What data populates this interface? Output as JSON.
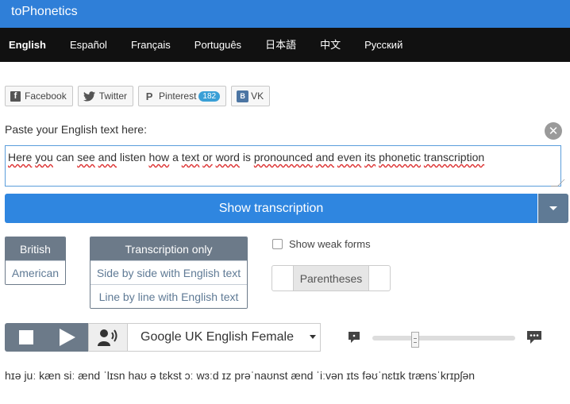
{
  "brand": "toPhonetics",
  "languages": [
    "English",
    "Español",
    "Français",
    "Português",
    "日本語",
    "中文",
    "Русский"
  ],
  "social": {
    "facebook": "Facebook",
    "twitter": "Twitter",
    "pinterest": "Pinterest",
    "pinterest_count": "182",
    "vk": "VK"
  },
  "input": {
    "label": "Paste your English text here:",
    "words": [
      "Here",
      "you",
      "can",
      "see",
      "and",
      "listen",
      "how",
      "a",
      "text",
      "or",
      "word",
      "is",
      "pronounced",
      "and",
      "even",
      "its",
      "phonetic",
      "transcription"
    ]
  },
  "show_button": "Show transcription",
  "accent": {
    "options": [
      "British",
      "American"
    ],
    "selected": "British"
  },
  "mode": {
    "options": [
      "Transcription only",
      "Side by side with English text",
      "Line by line with English text"
    ],
    "selected": "Transcription only"
  },
  "weak_forms": {
    "label": "Show weak forms",
    "checked": false
  },
  "parentheses": "Parentheses",
  "voice": {
    "selected": "Google UK English Female"
  },
  "speech_rate": 0.3,
  "transcription": "hɪə juː kæn siː ænd ˈlɪsn haʊ ə tɛkst ɔː wɜːd ɪz prəˈnaʊnst ænd ˈiːvən ɪts fəʊˈnɛtɪk trænsˈkrɪpʃən",
  "colors": {
    "topbar": "#2f7fd8",
    "langbar": "#111111",
    "primary": "#2f86e0",
    "secondary": "#6c7a89"
  }
}
